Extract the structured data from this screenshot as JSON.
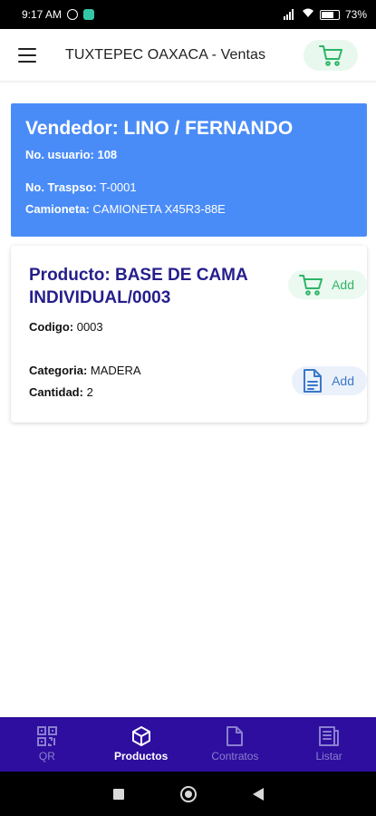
{
  "status_bar": {
    "time": "9:17 AM",
    "battery": "73%"
  },
  "app_bar": {
    "title": "TUXTEPEC OAXACA - Ventas",
    "cart_icon": "shopping-cart-icon"
  },
  "seller": {
    "title": "Vendedor: LINO / FERNANDO",
    "usuario_label": "No. usuario:",
    "usuario_value": "108",
    "traspaso_label": "No. Traspso:",
    "traspaso_value": "T-0001",
    "camioneta_label": "Camioneta:",
    "camioneta_value": "CAMIONETA X45R3-88E"
  },
  "product": {
    "title": "Producto: BASE DE CAMA INDIVIDUAL/0003",
    "codigo_label": "Codigo:",
    "codigo_value": "0003",
    "categoria_label": "Categoria:",
    "categoria_value": "MADERA",
    "cantidad_label": "Cantidad:",
    "cantidad_value": "2",
    "add_cart_label": "Add",
    "add_doc_label": "Add"
  },
  "bottom_nav": {
    "items": [
      {
        "label": "QR",
        "icon": "qr-code-icon",
        "active": false
      },
      {
        "label": "Productos",
        "icon": "box-icon",
        "active": true
      },
      {
        "label": "Contratos",
        "icon": "document-icon",
        "active": false
      },
      {
        "label": "Listar",
        "icon": "list-document-icon",
        "active": false
      }
    ]
  },
  "colors": {
    "seller_card": "#4a8cf7",
    "product_title": "#251e8c",
    "bottom_nav": "#2d0e9e",
    "cart_green": "#2db566",
    "doc_blue": "#3b78c8"
  }
}
